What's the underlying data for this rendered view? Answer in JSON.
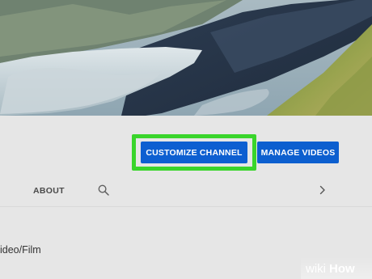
{
  "banner": {
    "description_icon": "mountain-landscape-banner"
  },
  "actions": {
    "customize_label": "CUSTOMIZE CHANNEL",
    "manage_label": "MANAGE VIDEOS"
  },
  "nav": {
    "about_label": "ABOUT",
    "search_icon": "search-icon",
    "next_icon": "chevron-right-icon"
  },
  "channel": {
    "category": "ideo/Film"
  },
  "watermark": {
    "brand": "wikiHow"
  },
  "colors": {
    "button_blue": "#0d5fd1",
    "highlight_green": "#39d52b",
    "page_grey": "#e6e6e6"
  }
}
